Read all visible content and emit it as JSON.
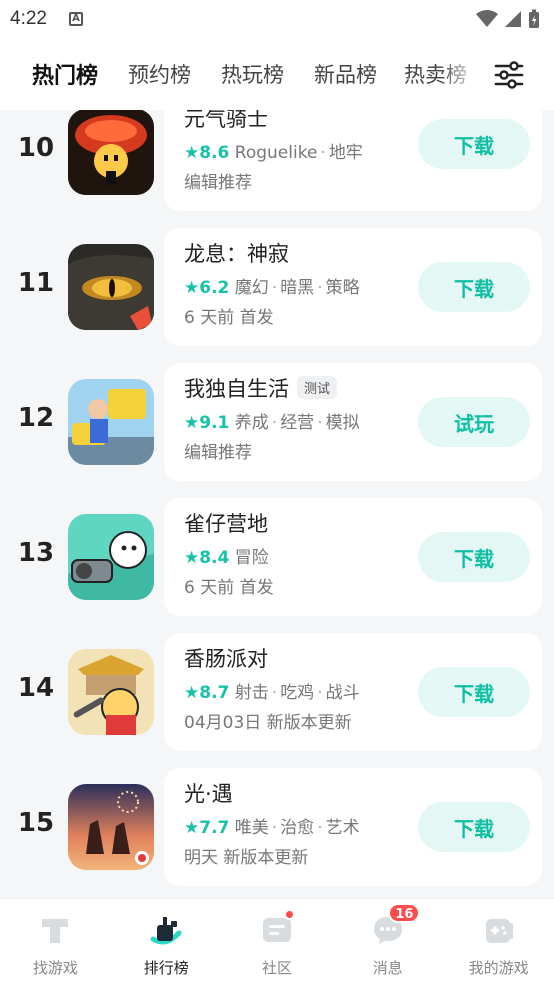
{
  "status_bar": {
    "time": "4:22"
  },
  "tabs": [
    {
      "label": "热门榜",
      "active": true
    },
    {
      "label": "预约榜"
    },
    {
      "label": "热玩榜"
    },
    {
      "label": "新品榜"
    },
    {
      "label": "热卖榜"
    }
  ],
  "games": [
    {
      "rank": "10",
      "name": "元气骑士",
      "badge": "",
      "score": "8.6",
      "tags": [
        "Roguelike",
        "地牢"
      ],
      "note": "编辑推荐",
      "action": "下载",
      "icon": "soul-knight-icon"
    },
    {
      "rank": "11",
      "name": "龙息：神寂",
      "badge": "",
      "score": "6.2",
      "tags": [
        "魔幻",
        "暗黑",
        "策略"
      ],
      "note": "6 天前 首发",
      "action": "下载",
      "icon": "dragon-eye-icon"
    },
    {
      "rank": "12",
      "name": "我独自生活",
      "badge": "测试",
      "score": "9.1",
      "tags": [
        "养成",
        "经营",
        "模拟"
      ],
      "note": "编辑推荐",
      "action": "试玩",
      "icon": "living-alone-icon"
    },
    {
      "rank": "13",
      "name": "雀仔营地",
      "badge": "",
      "score": "8.4",
      "tags": [
        "冒险"
      ],
      "note": "6 天前 首发",
      "action": "下载",
      "icon": "bird-camp-icon"
    },
    {
      "rank": "14",
      "name": "香肠派对",
      "badge": "",
      "score": "8.7",
      "tags": [
        "射击",
        "吃鸡",
        "战斗"
      ],
      "note": "04月03日 新版本更新",
      "action": "下载",
      "icon": "sausage-party-icon"
    },
    {
      "rank": "15",
      "name": "光·遇",
      "badge": "",
      "score": "7.7",
      "tags": [
        "唯美",
        "治愈",
        "艺术"
      ],
      "note": "明天 新版本更新",
      "action": "下载",
      "icon": "sky-icon"
    }
  ],
  "bottom_nav": [
    {
      "label": "找游戏",
      "icon": "find-game-icon"
    },
    {
      "label": "排行榜",
      "icon": "ranking-icon",
      "active": true
    },
    {
      "label": "社区",
      "icon": "community-icon",
      "dot": true
    },
    {
      "label": "消息",
      "icon": "message-icon",
      "badge": "16"
    },
    {
      "label": "我的游戏",
      "icon": "my-games-icon"
    }
  ],
  "colors": {
    "accent": "#16c3a8",
    "accent_bg": "#e3f8f4",
    "badge_red": "#ff4d4d"
  }
}
